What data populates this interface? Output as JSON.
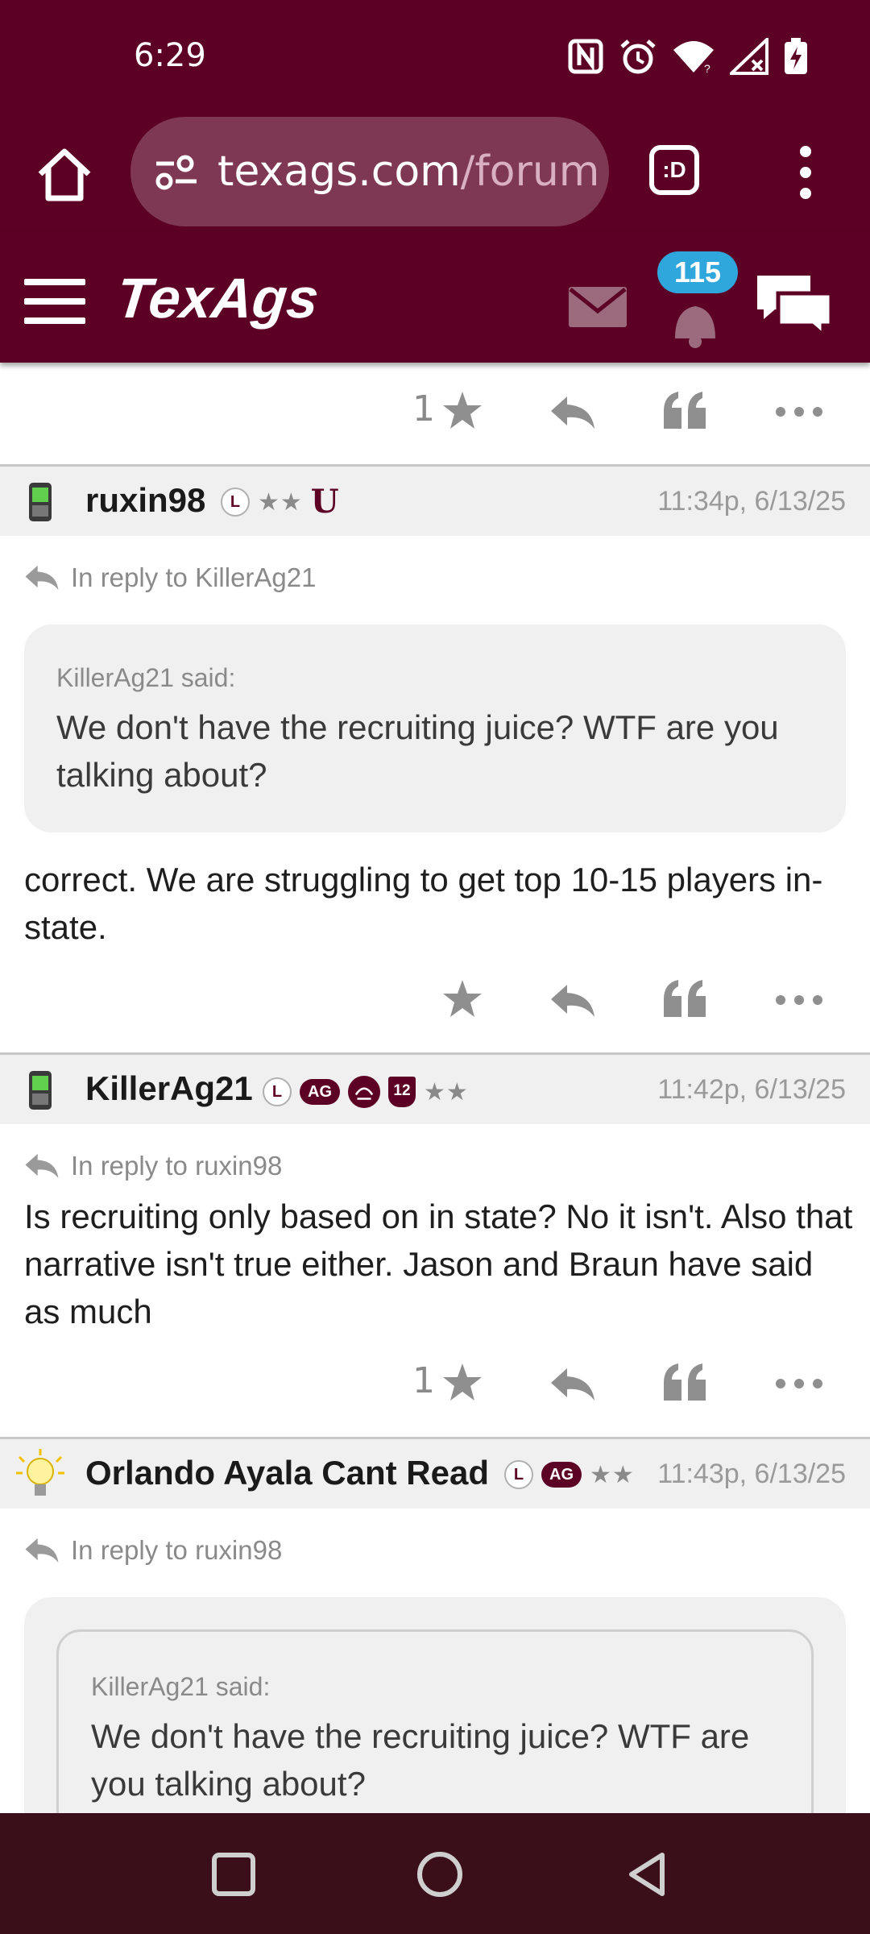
{
  "status_bar": {
    "time": "6:29",
    "icons": [
      "nfc-icon",
      "alarm-icon",
      "wifi-icon",
      "signal-icon",
      "battery-charging-icon"
    ]
  },
  "browser": {
    "url_host": "texags.com",
    "url_path": "/forum",
    "tabs_label": ":D",
    "icons": [
      "home-icon",
      "site-settings-icon",
      "tab-switcher-icon",
      "more-vert-icon"
    ]
  },
  "site_header": {
    "logo": "TexAgs",
    "notification_count": "115",
    "icons": [
      "hamburger-menu-icon",
      "mail-icon",
      "bell-icon",
      "chat-bubbles-icon"
    ]
  },
  "colors": {
    "brand_maroon": "#5c0025",
    "badge_blue": "#2fa6dc",
    "nav_bar": "#3b0f1a"
  },
  "posts": [
    {
      "like_count": "1"
    },
    {
      "username": "ruxin98",
      "badges": [
        "L",
        "★★",
        "U"
      ],
      "timestamp": "11:34p, 6/13/25",
      "reply_to": "In reply to KillerAg21",
      "quote_attr": "KillerAg21 said:",
      "quote_text": "We don't have the recruiting juice? WTF are you talking about?",
      "body": "correct. We are struggling to get top 10-15 players in-state.",
      "like_count": ""
    },
    {
      "username": "KillerAg21",
      "badges": [
        "L",
        "AG",
        "12",
        "★★"
      ],
      "timestamp": "11:42p, 6/13/25",
      "reply_to": "In reply to ruxin98",
      "body": "Is recruiting only based on in state? No it isn't. Also that narrative isn't true either. Jason and Braun have said as much",
      "like_count": "1"
    },
    {
      "username": "Orlando Ayala Cant Read",
      "badges": [
        "L",
        "AG",
        "★★"
      ],
      "timestamp": "11:43p, 6/13/25",
      "reply_to": "In reply to ruxin98",
      "quote_attr": "KillerAg21 said:",
      "quote_text": "We don't have the recruiting juice? WTF are you talking about?"
    }
  ],
  "nav_bar": {
    "icons": [
      "recents-square-icon",
      "home-circle-icon",
      "back-triangle-icon"
    ]
  }
}
